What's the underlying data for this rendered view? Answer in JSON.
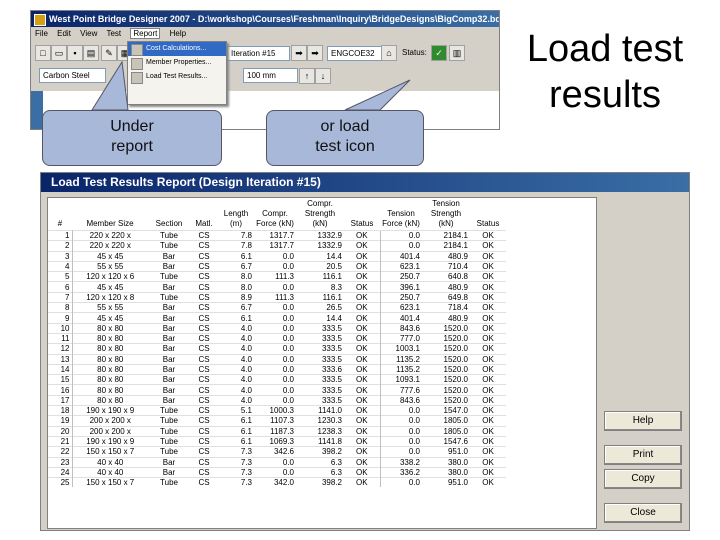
{
  "slide": {
    "title_line1": "Load test",
    "title_line2": "results",
    "callout_left_line1": "Under",
    "callout_left_line2": "report",
    "callout_right_line1": "or load",
    "callout_right_line2": "test icon"
  },
  "app_window": {
    "title": "West Point Bridge Designer 2007 - D:\\workshop\\Courses\\Freshman\\Inquiry\\BridgeDesigns\\BigComp32.bdc",
    "menus": [
      "File",
      "Edit",
      "View",
      "Test",
      "Report",
      "Help"
    ],
    "active_menu": "Report",
    "material_combo": "Carbon Steel",
    "iteration_combo": "Iteration #15",
    "size_combo": "100 mm",
    "load_combo": "ENGCOE32",
    "status_label": "Status:",
    "report_menu_items": [
      "Cost Calculations...",
      "Member Properties...",
      "Load Test Results..."
    ]
  },
  "report_window": {
    "title": "Load Test Results Report (Design Iteration #15)",
    "columns": [
      "#",
      "Member Size",
      "Section",
      "Matl.",
      "Length (m)",
      "Compr. Force (kN)",
      "Compr. Strength (kN)",
      "Status",
      "Tension Force (kN)",
      "Tension Strength (kN)",
      "Status"
    ],
    "rows": [
      [
        "1",
        "220 x 220 x",
        "Tube",
        "CS",
        "7.8",
        "1317.7",
        "1332.9",
        "OK",
        "0.0",
        "2184.1",
        "OK"
      ],
      [
        "2",
        "220 x 220 x",
        "Tube",
        "CS",
        "7.8",
        "1317.7",
        "1332.9",
        "OK",
        "0.0",
        "2184.1",
        "OK"
      ],
      [
        "3",
        "45 x 45",
        "Bar",
        "CS",
        "6.1",
        "0.0",
        "14.4",
        "OK",
        "401.4",
        "480.9",
        "OK"
      ],
      [
        "4",
        "55 x 55",
        "Bar",
        "CS",
        "6.7",
        "0.0",
        "20.5",
        "OK",
        "623.1",
        "710.4",
        "OK"
      ],
      [
        "5",
        "120 x 120 x 6",
        "Tube",
        "CS",
        "8.0",
        "111.3",
        "116.1",
        "OK",
        "250.7",
        "640.8",
        "OK"
      ],
      [
        "6",
        "45 x 45",
        "Bar",
        "CS",
        "8.0",
        "0.0",
        "8.3",
        "OK",
        "396.1",
        "480.9",
        "OK"
      ],
      [
        "7",
        "120 x 120 x 8",
        "Tube",
        "CS",
        "8.9",
        "111.3",
        "116.1",
        "OK",
        "250.7",
        "649.8",
        "OK"
      ],
      [
        "8",
        "55 x 55",
        "Bar",
        "CS",
        "6.7",
        "0.0",
        "26.5",
        "OK",
        "623.1",
        "718.4",
        "OK"
      ],
      [
        "9",
        "45 x 45",
        "Bar",
        "CS",
        "6.1",
        "0.0",
        "14.4",
        "OK",
        "401.4",
        "480.9",
        "OK"
      ],
      [
        "10",
        "80 x 80",
        "Bar",
        "CS",
        "4.0",
        "0.0",
        "333.5",
        "OK",
        "843.6",
        "1520.0",
        "OK"
      ],
      [
        "11",
        "80 x 80",
        "Bar",
        "CS",
        "4.0",
        "0.0",
        "333.5",
        "OK",
        "777.0",
        "1520.0",
        "OK"
      ],
      [
        "12",
        "80 x 80",
        "Bar",
        "CS",
        "4.0",
        "0.0",
        "333.5",
        "OK",
        "1003.1",
        "1520.0",
        "OK"
      ],
      [
        "13",
        "80 x 80",
        "Bar",
        "CS",
        "4.0",
        "0.0",
        "333.5",
        "OK",
        "1135.2",
        "1520.0",
        "OK"
      ],
      [
        "14",
        "80 x 80",
        "Bar",
        "CS",
        "4.0",
        "0.0",
        "333.6",
        "OK",
        "1135.2",
        "1520.0",
        "OK"
      ],
      [
        "15",
        "80 x 80",
        "Bar",
        "CS",
        "4.0",
        "0.0",
        "333.5",
        "OK",
        "1093.1",
        "1520.0",
        "OK"
      ],
      [
        "16",
        "80 x 80",
        "Bar",
        "CS",
        "4.0",
        "0.0",
        "333.5",
        "OK",
        "777.6",
        "1520.0",
        "OK"
      ],
      [
        "17",
        "80 x 80",
        "Bar",
        "CS",
        "4.0",
        "0.0",
        "333.5",
        "OK",
        "843.6",
        "1520.0",
        "OK"
      ],
      [
        "18",
        "190 x 190 x 9",
        "Tube",
        "CS",
        "5.1",
        "1000.3",
        "1141.0",
        "OK",
        "0.0",
        "1547.0",
        "OK"
      ],
      [
        "19",
        "200 x 200 x",
        "Tube",
        "CS",
        "6.1",
        "1107.3",
        "1230.3",
        "OK",
        "0.0",
        "1805.0",
        "OK"
      ],
      [
        "20",
        "200 x 200 x",
        "Tube",
        "CS",
        "6.1",
        "1187.3",
        "1238.3",
        "OK",
        "0.0",
        "1805.0",
        "OK"
      ],
      [
        "21",
        "190 x 190 x 9",
        "Tube",
        "CS",
        "6.1",
        "1069.3",
        "1141.8",
        "OK",
        "0.0",
        "1547.6",
        "OK"
      ],
      [
        "22",
        "150 x 150 x 7",
        "Tube",
        "CS",
        "7.3",
        "342.6",
        "398.2",
        "OK",
        "0.0",
        "951.0",
        "OK"
      ],
      [
        "23",
        "40 x 40",
        "Bar",
        "CS",
        "7.3",
        "0.0",
        "6.3",
        "OK",
        "338.2",
        "380.0",
        "OK"
      ],
      [
        "24",
        "40 x 40",
        "Bar",
        "CS",
        "7.3",
        "0.0",
        "6.3",
        "OK",
        "336.2",
        "380.0",
        "OK"
      ],
      [
        "25",
        "150 x 150 x 7",
        "Tube",
        "CS",
        "7.3",
        "342.0",
        "398.2",
        "OK",
        "0.0",
        "951.0",
        "OK"
      ]
    ],
    "buttons": {
      "help": "Help",
      "print": "Print",
      "copy": "Copy",
      "close": "Close"
    }
  }
}
